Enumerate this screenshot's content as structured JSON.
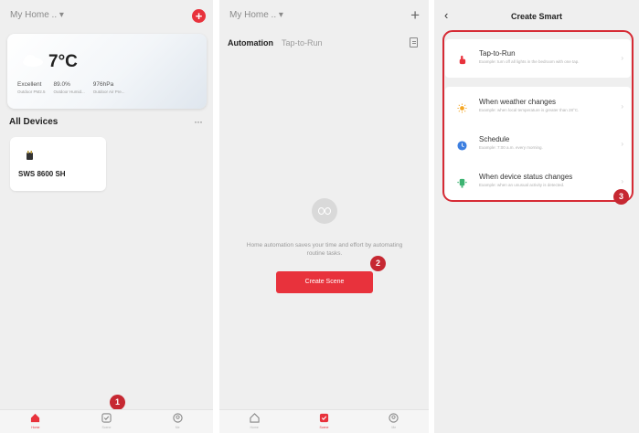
{
  "screen1": {
    "home_title": "My Home .. ▾",
    "weather": {
      "temperature": "7°C",
      "metrics": [
        {
          "value": "Excellent",
          "label": "Outdoor PM2.5"
        },
        {
          "value": "89.0%",
          "label": "Outdoor Humid..."
        },
        {
          "value": "976hPa",
          "label": "Outdoor Air Pre..."
        }
      ]
    },
    "devices_heading": "All Devices",
    "more_label": "···",
    "device": {
      "name": "SWS 8600 SH"
    },
    "tabbar": [
      {
        "label": "Home",
        "active": true
      },
      {
        "label": "Scene",
        "active": false
      },
      {
        "label": "Me",
        "active": false
      }
    ],
    "badge": "1"
  },
  "screen2": {
    "home_title": "My Home .. ▾",
    "tabs": {
      "automation": "Automation",
      "tap_to_run": "Tap-to-Run"
    },
    "empty_text": "Home automation saves your time and effort by automating routine tasks.",
    "create_button": "Create Scene",
    "badge": "2",
    "tabbar": [
      {
        "label": "Home",
        "active": false
      },
      {
        "label": "Scene",
        "active": true
      },
      {
        "label": "Me",
        "active": false
      }
    ]
  },
  "screen3": {
    "back": "‹",
    "title": "Create Smart",
    "options": [
      {
        "title": "Tap-to-Run",
        "desc": "Example: turn off all lights in the bedroom with one tap.",
        "icon": "hand-tap-icon",
        "color": "#e8323c"
      },
      {
        "title": "When weather changes",
        "desc": "Example: when local temperature is greater than 28°C.",
        "icon": "sun-icon",
        "color": "#f5a623"
      },
      {
        "title": "Schedule",
        "desc": "Example: 7:00 a.m. every morning.",
        "icon": "clock-icon",
        "color": "#3d7fe0"
      },
      {
        "title": "When device status changes",
        "desc": "Example: when an unusual activity is detected.",
        "icon": "device-icon",
        "color": "#3cb371"
      }
    ],
    "chevron": "›",
    "badge": "3"
  },
  "colors": {
    "accent": "#e8323c",
    "badge": "#c62832"
  }
}
